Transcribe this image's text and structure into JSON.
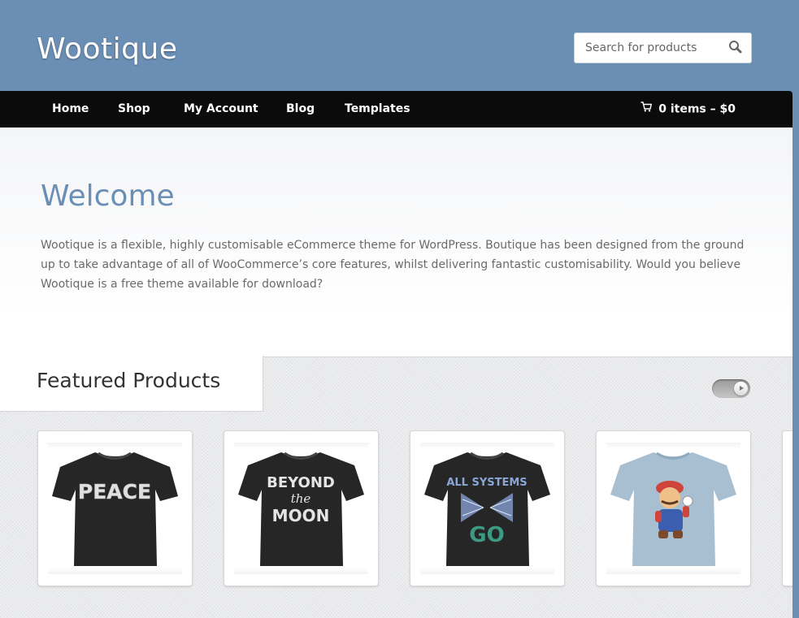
{
  "header": {
    "site_title": "Wootique",
    "search_placeholder": "Search for products"
  },
  "nav": {
    "items": [
      {
        "label": "Home"
      },
      {
        "label": "Shop"
      },
      {
        "label": "My Account"
      },
      {
        "label": "Blog"
      },
      {
        "label": "Templates"
      }
    ],
    "cart_label": "0 items – $0"
  },
  "welcome": {
    "title": "Welcome",
    "text": "Wootique is a flexible, highly customisable eCommerce theme for WordPress. Boutique has been designed from the ground up to take advantage of all of WooCommerce’s core features, whilst delivering fantastic customisability. Would you believe Wootique is a free theme available for download?"
  },
  "featured": {
    "title": "Featured Products",
    "products": [
      {
        "print": "PEACE",
        "shirt_color": "#262626"
      },
      {
        "print_line1": "BEYOND",
        "print_line2": "the",
        "print_line3": "MOON",
        "shirt_color": "#262626"
      },
      {
        "print_line1": "ALL SYSTEMS",
        "print_line2": "GO",
        "shirt_color": "#262626"
      },
      {
        "print": "plumber character",
        "shirt_color": "#a7bfd0"
      }
    ]
  },
  "colors": {
    "header_bg": "#6b8fb4",
    "nav_bg": "#0b0b0b",
    "accent": "#6b8fb4"
  },
  "icons": [
    "search-icon",
    "cart-icon",
    "play-toggle-icon"
  ]
}
